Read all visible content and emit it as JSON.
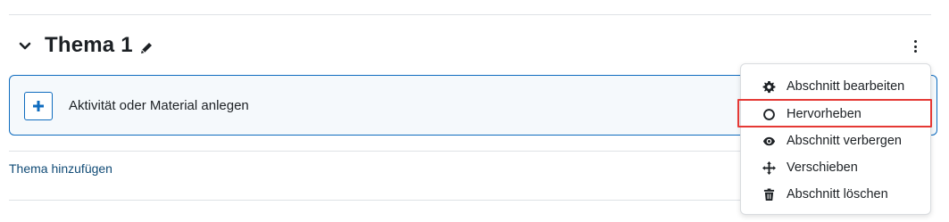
{
  "section": {
    "title": "Thema 1"
  },
  "activity": {
    "add_label": "Aktivität oder Material anlegen"
  },
  "footer": {
    "add_topic_label": "Thema hinzufügen"
  },
  "menu": {
    "items": [
      {
        "label": "Abschnitt bearbeiten",
        "icon": "gear-icon"
      },
      {
        "label": "Hervorheben",
        "icon": "circle-icon"
      },
      {
        "label": "Abschnitt verbergen",
        "icon": "eye-icon"
      },
      {
        "label": "Verschieben",
        "icon": "move-icon"
      },
      {
        "label": "Abschnitt löschen",
        "icon": "trash-icon"
      }
    ],
    "highlight_color": "#e53935"
  },
  "colors": {
    "accent": "#0f6cbf",
    "link": "#0f4a75",
    "text": "#1d2125"
  }
}
